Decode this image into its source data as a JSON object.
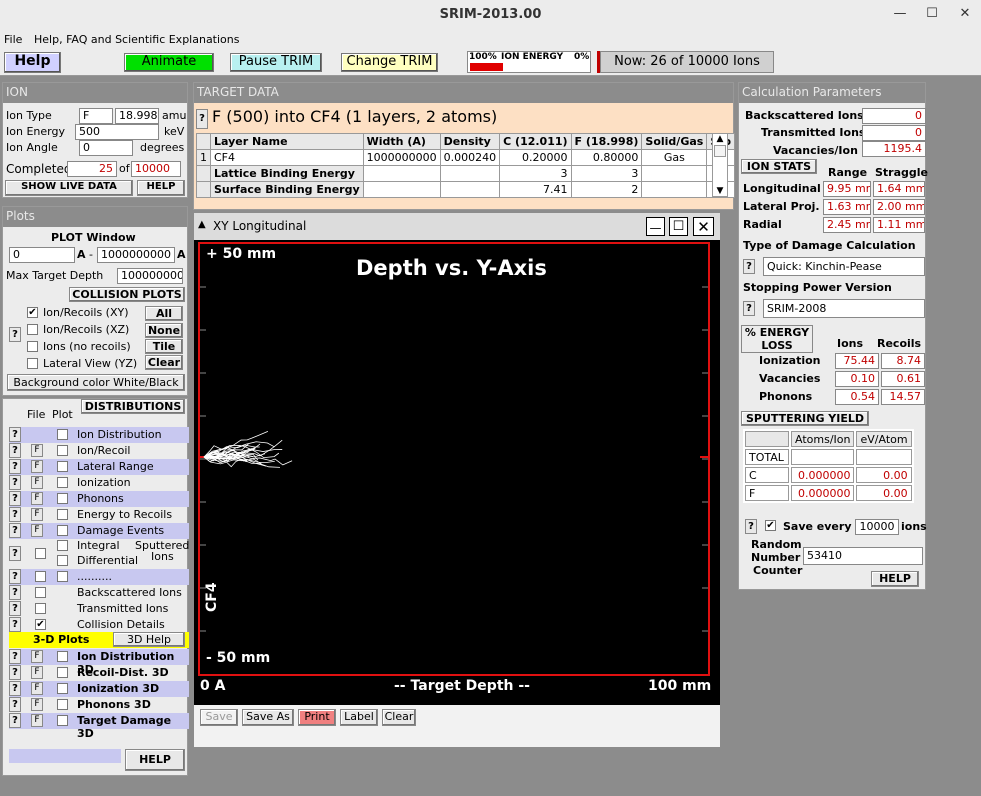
{
  "window": {
    "title": "SRIM-2013.00"
  },
  "menu": [
    "File",
    "Help, FAQ and Scientific Explanations"
  ],
  "toolbar": {
    "help": "Help",
    "animate": "Animate",
    "pause": "Pause TRIM",
    "change": "Change TRIM",
    "energy_left": "100%",
    "energy_label": "ION ENERGY",
    "energy_right": "0%",
    "energy_progress": 0.28,
    "now": "Now: 26 of 10000 Ions"
  },
  "ion": {
    "header": "ION",
    "type_label": "Ion Type",
    "type": "F",
    "mass": "18.998",
    "mass_unit": "amu",
    "energy_label": "Ion Energy",
    "energy": "500",
    "energy_unit": "keV",
    "angle_label": "Ion Angle",
    "angle": "0",
    "angle_unit": "degrees",
    "completed_label": "Completed",
    "completed": "25",
    "of": "of",
    "total": "10000",
    "show_live": "SHOW LIVE DATA",
    "help": "HELP"
  },
  "plots": {
    "header": "Plots",
    "window_label": "PLOT   Window",
    "win_from": "0",
    "a1": "A",
    "dash": "-",
    "win_to": "1000000000",
    "a2": "A",
    "max_depth_label": "Max Target Depth",
    "max_depth": "1000000000",
    "collision_header": "COLLISION PLOTS",
    "q": "?",
    "options": [
      {
        "label": "Ion/Recoils (XY)",
        "checked": "✔"
      },
      {
        "label": "Ion/Recoils (XZ)",
        "checked": ""
      },
      {
        "label": "Ions (no recoils)",
        "checked": ""
      },
      {
        "label": "Lateral View (YZ)",
        "checked": ""
      }
    ],
    "btn_all": "All",
    "btn_none": "None",
    "btn_tile": "Tile",
    "btn_clear": "Clear",
    "background_btn": "Background color White/Black"
  },
  "distributions": {
    "file": "File",
    "plot": "Plot",
    "header": "DISTRIBUTIONS",
    "rows": [
      {
        "name": "Ion Distribution",
        "f": "",
        "chk": ""
      },
      {
        "name": "Ion/Recoil Distribution",
        "f": "F",
        "chk": ""
      },
      {
        "name": "Lateral Range",
        "f": "F",
        "chk": ""
      },
      {
        "name": "Ionization",
        "f": "F",
        "chk": ""
      },
      {
        "name": "Phonons",
        "f": "F",
        "chk": ""
      },
      {
        "name": "Energy to Recoils",
        "f": "F",
        "chk": ""
      },
      {
        "name": "Damage Events",
        "f": "F",
        "chk": ""
      }
    ],
    "integral": "Integral",
    "differential": "Differential",
    "sputtered": "Sputtered",
    "ions": "Ions",
    "dots": "..........",
    "backscattered": "Backscattered Ions",
    "transmitted": "Transmitted Ions",
    "collision": "Collision Details",
    "collision_check": "✔",
    "plots3d": "3-D Plots",
    "help3d": "3D Help",
    "rows3d": [
      {
        "name": "Ion Distribution 3D",
        "f": "F"
      },
      {
        "name": "Recoil-Dist. 3D",
        "f": "F"
      },
      {
        "name": "Ionization 3D",
        "f": "F"
      },
      {
        "name": "Phonons 3D",
        "f": "F"
      },
      {
        "name": "Target Damage 3D",
        "f": "F"
      }
    ],
    "help": "HELP"
  },
  "target": {
    "header": "TARGET DATA",
    "title": "F (500) into CF4 (1 layers, 2 atoms)",
    "q": "?",
    "columns": [
      "Layer Name",
      "Width (A)",
      "Density",
      "C (12.011)",
      "F (18.998)",
      "Solid/Gas",
      "Sto"
    ],
    "rows": [
      {
        "idx": "1",
        "cells": [
          "CF4",
          "1000000000",
          "0.000240",
          "0.20000",
          "0.80000",
          "Gas",
          ""
        ]
      },
      {
        "idx": "",
        "cells": [
          "Lattice Binding Energy",
          "",
          "",
          "3",
          "3",
          "",
          ""
        ]
      },
      {
        "idx": "",
        "cells": [
          "Surface Binding Energy",
          "",
          "",
          "7.41",
          "2",
          "",
          ""
        ]
      }
    ]
  },
  "plot": {
    "title": "XY Longitudinal",
    "chart_title": "Depth vs. Y-Axis",
    "top": "+ 50 mm",
    "bottom": "- 50 mm",
    "layer": "CF4",
    "x_left": "0 A",
    "x_mid": "-- Target Depth --",
    "x_right": "100 mm",
    "buttons": [
      "Save",
      "Save As",
      "Print",
      "Label",
      "Clear"
    ]
  },
  "calc": {
    "header": "Calculation Parameters",
    "backscattered_label": "Backscattered Ions",
    "backscattered": "0",
    "transmitted_label": "Transmitted Ions",
    "transmitted": "0",
    "vacancies_label": "Vacancies/Ion",
    "vacancies": "1195.4",
    "stats_header": "ION STATS",
    "range": "Range",
    "straggle": "Straggle",
    "stats": [
      {
        "label": "Longitudinal",
        "range": "9.95 mm",
        "straggle": "1.64 mm"
      },
      {
        "label": "Lateral Proj.",
        "range": "1.63 mm",
        "straggle": "2.00 mm"
      },
      {
        "label": "Radial",
        "range": "2.45 mm",
        "straggle": "1.11 mm"
      }
    ],
    "damage_label": "Type of Damage Calculation",
    "damage": "Quick: Kinchin-Pease",
    "stopping_label": "Stopping Power Version",
    "stopping": "SRIM-2008",
    "q": "?",
    "energy_header1": "% ENERGY",
    "energy_header2": "LOSS",
    "ions_col": "Ions",
    "recoils_col": "Recoils",
    "energy": [
      {
        "label": "Ionization",
        "ions": "75.44",
        "recoils": "8.74"
      },
      {
        "label": "Vacancies",
        "ions": "0.10",
        "recoils": "0.61"
      },
      {
        "label": "Phonons",
        "ions": "0.54",
        "recoils": "14.57"
      }
    ],
    "sputter_header": "SPUTTERING YIELD",
    "atoms_col": "Atoms/Ion",
    "ev_col": "eV/Atom",
    "sputter": [
      {
        "label": "TOTAL",
        "atoms": "",
        "ev": ""
      },
      {
        "label": "C",
        "atoms": "0.000000",
        "ev": "0.00"
      },
      {
        "label": "F",
        "atoms": "0.000000",
        "ev": "0.00"
      }
    ],
    "save_every_label": "Save every",
    "save_every": "10000",
    "ions_label": "ions",
    "save_check": "✔",
    "random1": "Random",
    "random2": "Number",
    "random3": "Counter",
    "random": "53410",
    "help": "HELP"
  },
  "colors": {
    "animate": "#00e000",
    "pause": "#b8f0f0",
    "change": "#ffffc0",
    "trace": "#ffffff",
    "frame": "#e01010"
  }
}
